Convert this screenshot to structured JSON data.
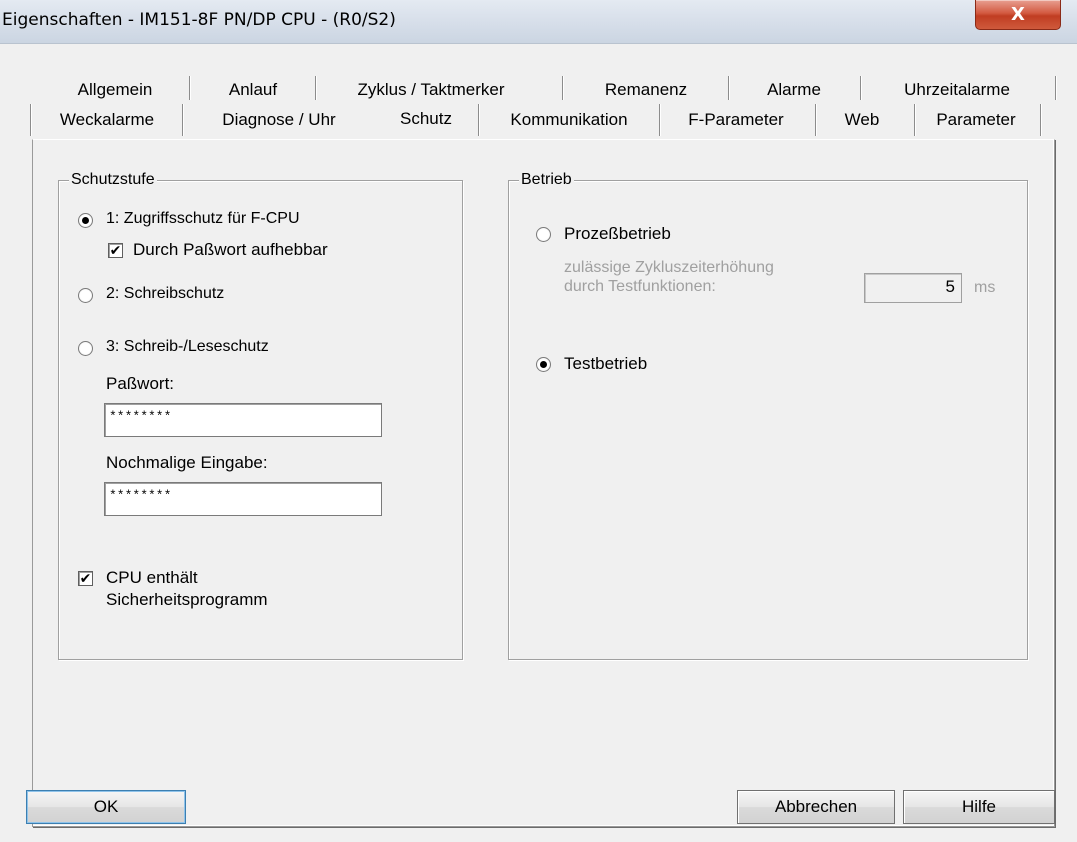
{
  "window": {
    "title": "Eigenschaften - IM151-8F PN/DP CPU - (R0/S2)",
    "close_label": "X"
  },
  "tabs": {
    "row1": [
      "Allgemein",
      "Anlauf",
      "Zyklus / Taktmerker",
      "Remanenz",
      "Alarme",
      "Uhrzeitalarme"
    ],
    "row2": [
      "Weckalarme",
      "Diagnose / Uhr",
      "Schutz",
      "Kommunikation",
      "F-Parameter",
      "Web",
      "Parameter"
    ],
    "active": "Schutz"
  },
  "schutzstufe": {
    "legend": "Schutzstufe",
    "option1": {
      "label": "1: Zugriffsschutz für F-CPU",
      "selected": true
    },
    "password_removable": {
      "label": "Durch Paßwort aufhebbar",
      "checked": true
    },
    "option2": {
      "label": "2: Schreibschutz",
      "selected": false
    },
    "option3": {
      "label": "3: Schreib-/Leseschutz",
      "selected": false
    },
    "password_label": "Paßwort:",
    "password_value": "********",
    "repeat_label": "Nochmalige Eingabe:",
    "repeat_value": "********",
    "safety_program": {
      "label_line1": "CPU enthält",
      "label_line2": "Sicherheitsprogramm",
      "checked": true
    }
  },
  "betrieb": {
    "legend": "Betrieb",
    "process_mode": {
      "label": "Prozeßbetrieb",
      "selected": false
    },
    "cycle_label_line1": "zulässige Zykluszeiterhöhung",
    "cycle_label_line2": "durch Testfunktionen:",
    "cycle_value": "5",
    "cycle_unit": "ms",
    "test_mode": {
      "label": "Testbetrieb",
      "selected": true
    }
  },
  "buttons": {
    "ok": "OK",
    "cancel": "Abbrechen",
    "help": "Hilfe"
  },
  "check_mark": "✔"
}
